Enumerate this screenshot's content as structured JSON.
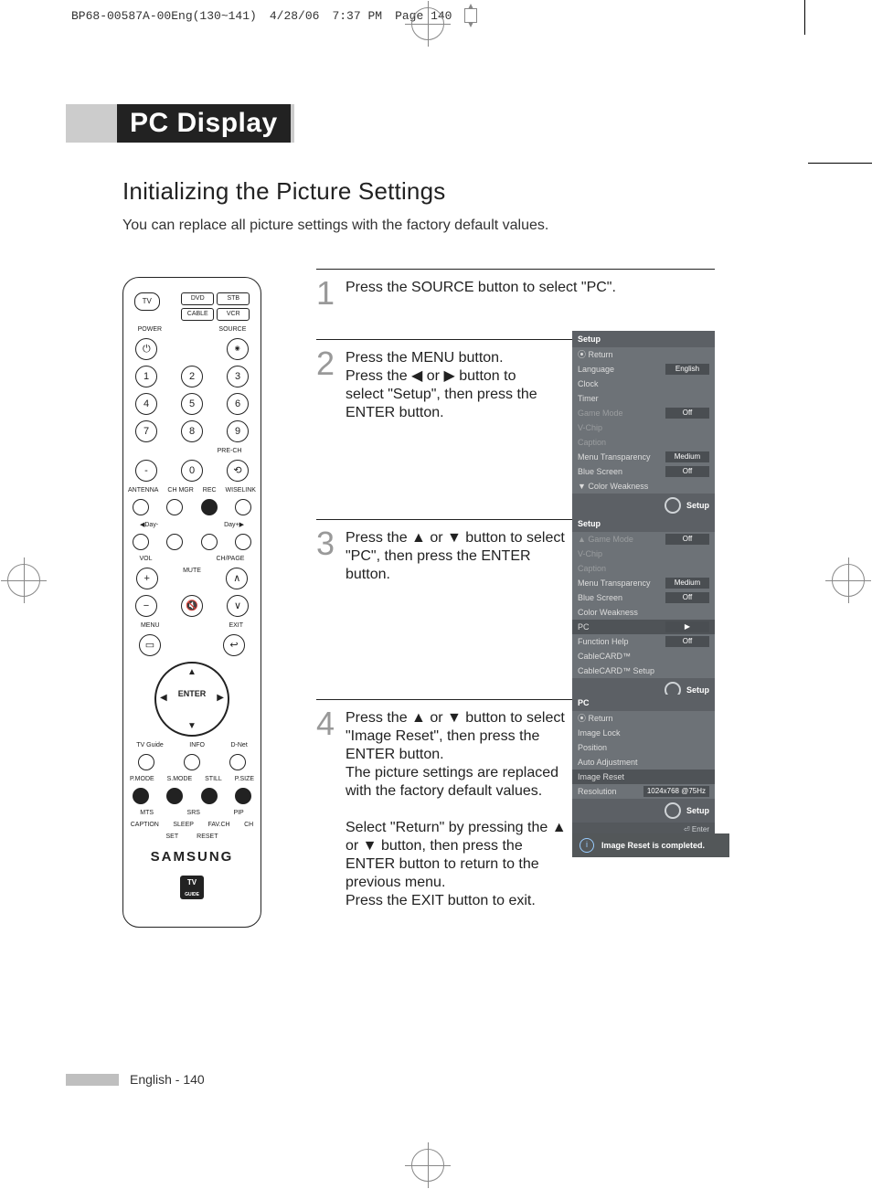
{
  "print_header": {
    "file": "BP68-00587A-00Eng(130~141)",
    "date": "4/28/06",
    "time": "7:37 PM",
    "page": "Page 140"
  },
  "title_bar": "PC Display",
  "subtitle": "Initializing the Picture Settings",
  "lead": "You can replace all picture settings with the factory default values.",
  "steps": [
    {
      "n": "1",
      "text": "Press the SOURCE button to select \"PC\"."
    },
    {
      "n": "2",
      "text": "Press the MENU button.\nPress the ◀ or ▶ button to select \"Setup\", then press the ENTER button."
    },
    {
      "n": "3",
      "text": "Press the ▲ or ▼ button to select \"PC\", then press the ENTER button."
    },
    {
      "n": "4",
      "text": "Press the ▲ or ▼ button to select \"Image Reset\", then press the ENTER button.\nThe picture settings are replaced with the factory default values.\n\nSelect \"Return\" by pressing the ▲ or ▼ button, then press the ENTER button to return to the previous menu.\nPress the EXIT button to exit."
    }
  ],
  "osd": {
    "hdr": "Setup",
    "ftr": "Setup",
    "enter": "Enter",
    "return": "Return",
    "p1": [
      {
        "l": "Return",
        "v": ""
      },
      {
        "l": "Language",
        "v": "English"
      },
      {
        "l": "Clock",
        "v": ""
      },
      {
        "l": "Timer",
        "v": ""
      },
      {
        "l": "Game Mode",
        "v": "Off",
        "dim": true
      },
      {
        "l": "V-Chip",
        "v": "",
        "dim": true
      },
      {
        "l": "Caption",
        "v": "",
        "dim": true
      },
      {
        "l": "Menu Transparency",
        "v": "Medium"
      },
      {
        "l": "Blue Screen",
        "v": "Off"
      },
      {
        "l": "▼ Color Weakness",
        "v": ""
      }
    ],
    "p2": [
      {
        "l": "▲ Game Mode",
        "v": "Off",
        "dim": true
      },
      {
        "l": "V-Chip",
        "v": "",
        "dim": true
      },
      {
        "l": "Caption",
        "v": "",
        "dim": true
      },
      {
        "l": "Menu Transparency",
        "v": "Medium"
      },
      {
        "l": "Blue Screen",
        "v": "Off"
      },
      {
        "l": "Color Weakness",
        "v": ""
      },
      {
        "l": "PC",
        "v": "▶",
        "sel": true
      },
      {
        "l": "Function Help",
        "v": "Off"
      },
      {
        "l": "CableCARD™",
        "v": ""
      },
      {
        "l": "CableCARD™ Setup",
        "v": ""
      }
    ],
    "p3hdr": "PC",
    "p3": [
      {
        "l": "Return",
        "v": ""
      },
      {
        "l": "Image Lock",
        "v": ""
      },
      {
        "l": "Position",
        "v": ""
      },
      {
        "l": "Auto Adjustment",
        "v": ""
      },
      {
        "l": "Image Reset",
        "v": "",
        "sel": true
      },
      {
        "l": "Resolution",
        "v": "1024x768 @75Hz"
      }
    ],
    "msg": "Image Reset is completed."
  },
  "remote": {
    "mode_pills": [
      "DVD",
      "STB",
      "CABLE",
      "VCR"
    ],
    "tv": "TV",
    "power": "POWER",
    "source": "SOURCE",
    "nums": [
      "1",
      "2",
      "3",
      "4",
      "5",
      "6",
      "7",
      "8",
      "9",
      "-",
      "0"
    ],
    "prech": "PRE-CH",
    "row_small": [
      "ANTENNA",
      "CH MGR",
      "REC",
      "WISELINK"
    ],
    "day": [
      "◀Day-",
      "Day+▶"
    ],
    "vol": "VOL",
    "chpage": "CH/PAGE",
    "mute": "MUTE",
    "menu": "MENU",
    "exit": "EXIT",
    "enter": "ENTER",
    "row2": [
      "TV Guide",
      "INFO",
      "D-Net"
    ],
    "row3": [
      "P.MODE",
      "S.MODE",
      "STILL",
      "P.SIZE"
    ],
    "row4": [
      "MTS",
      "SRS",
      "PIP"
    ],
    "row5": [
      "CAPTION",
      "SLEEP",
      "FAV.CH",
      "CH"
    ],
    "setreset": [
      "SET",
      "RESET"
    ],
    "brand": "SAMSUNG",
    "tvguide": "TV\nGUIDE"
  },
  "footer": {
    "text": "English - 140"
  }
}
